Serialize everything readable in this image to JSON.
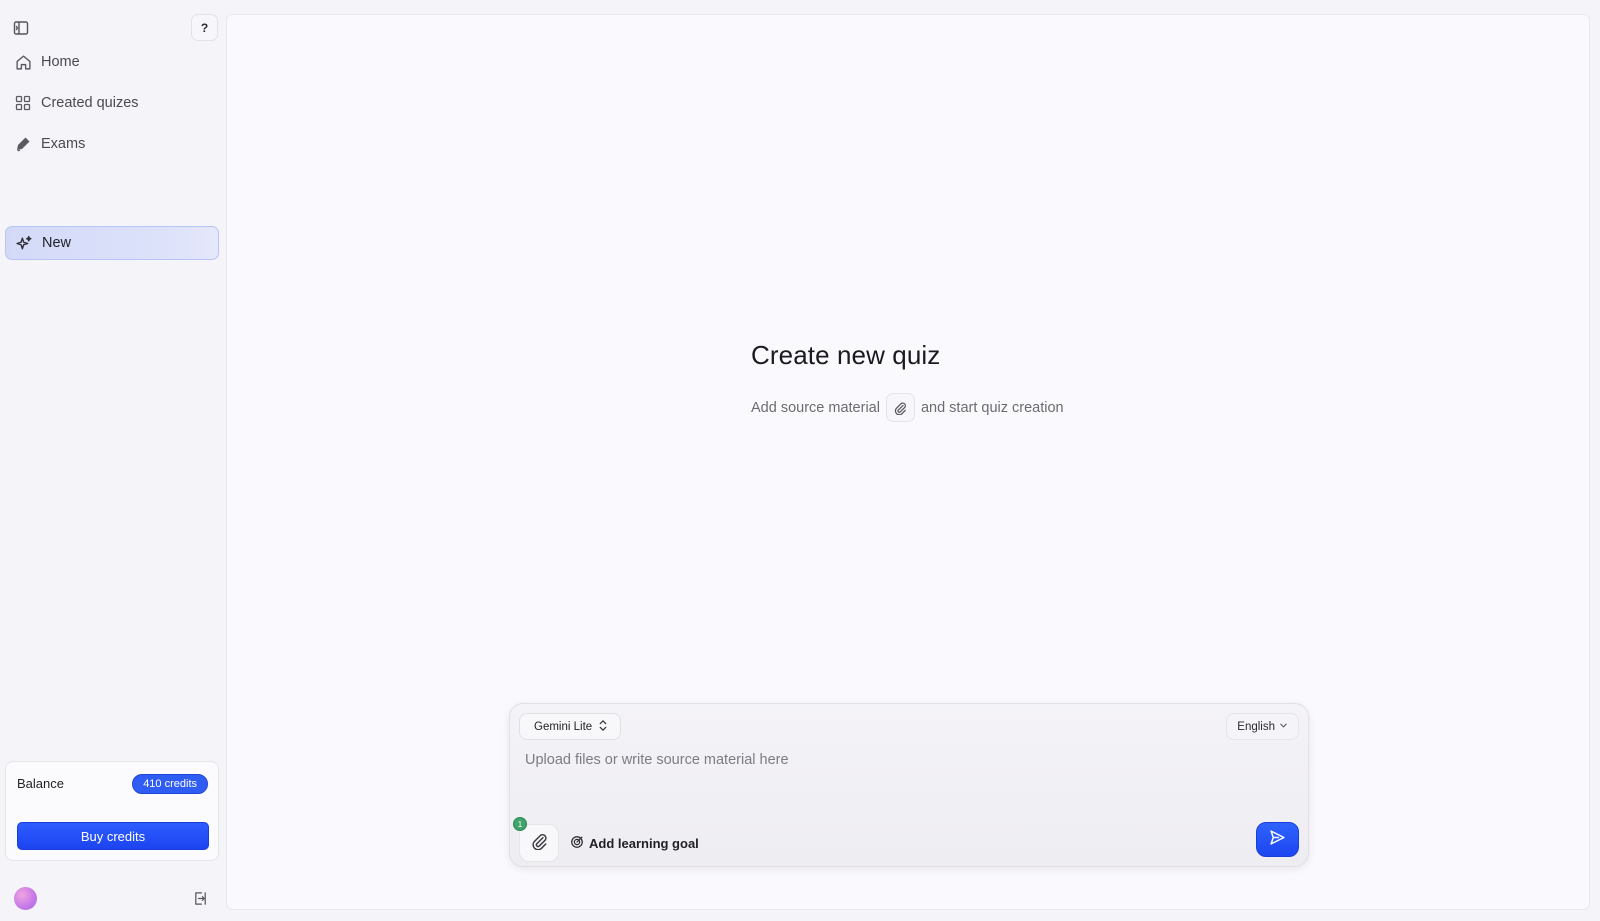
{
  "sidebar": {
    "toggle_icon": "sidebar-toggle-icon",
    "help_label": "?",
    "items": [
      {
        "label": "Home",
        "icon": "home-icon"
      },
      {
        "label": "Created quizes",
        "icon": "grid-icon"
      },
      {
        "label": "Exams",
        "icon": "pencil-icon"
      }
    ],
    "new_label": "New",
    "new_icon": "sparkles-icon",
    "balance": {
      "label": "Balance",
      "credits": "410 credits",
      "buy_label": "Buy credits"
    },
    "logout_icon": "logout-icon"
  },
  "main": {
    "title": "Create new quiz",
    "sub_before": "Add source material",
    "sub_after": "and start quiz creation"
  },
  "composer": {
    "model": "Gemini Lite",
    "language": "English",
    "placeholder": "Upload files or write source material here",
    "attach_count": "1",
    "goal_label": "Add learning goal"
  },
  "colors": {
    "accent": "#1f4af2",
    "badge_green": "#3fa36a",
    "new_highlight": "#d6dcf8"
  }
}
